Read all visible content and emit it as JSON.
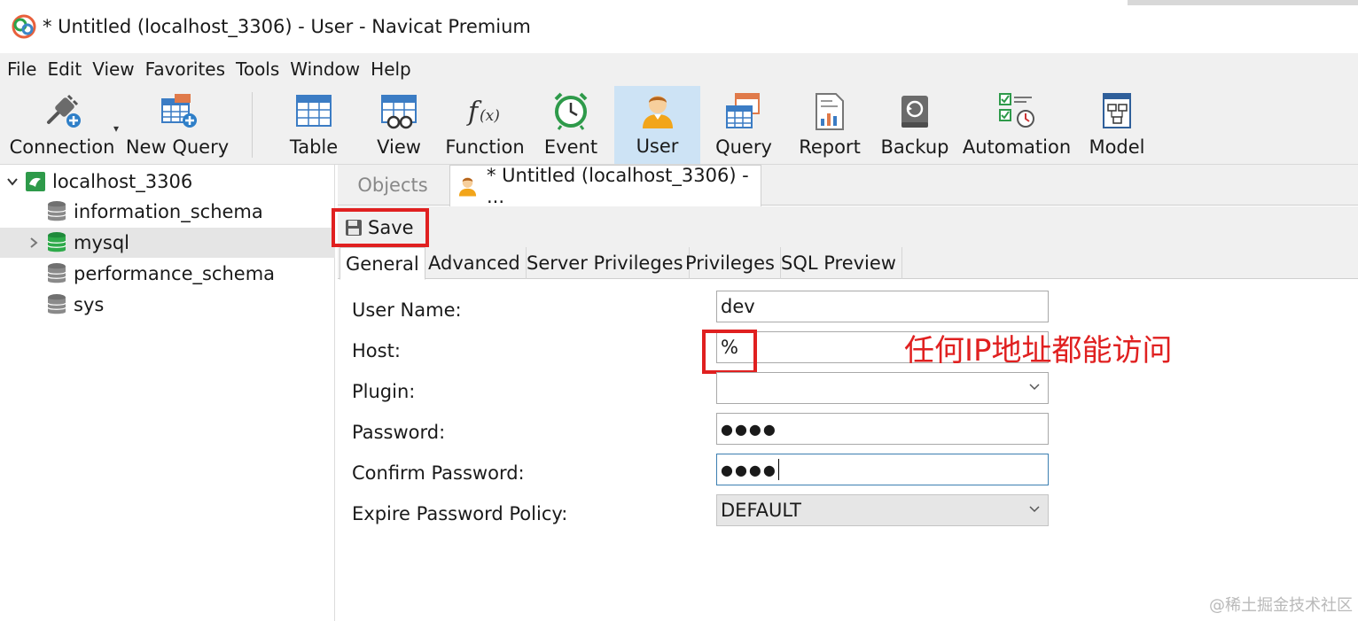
{
  "window": {
    "title": "* Untitled (localhost_3306) - User - Navicat Premium"
  },
  "menu": [
    "File",
    "Edit",
    "View",
    "Favorites",
    "Tools",
    "Window",
    "Help"
  ],
  "toolbar": {
    "connection": "Connection",
    "new_query": "New Query",
    "table": "Table",
    "view": "View",
    "function": "Function",
    "event": "Event",
    "user": "User",
    "query": "Query",
    "report": "Report",
    "backup": "Backup",
    "automation": "Automation",
    "model": "Model"
  },
  "sidebar": {
    "connection": "localhost_3306",
    "databases": [
      "information_schema",
      "mysql",
      "performance_schema",
      "sys"
    ]
  },
  "tabs": {
    "objects": "Objects",
    "document": "* Untitled (localhost_3306) - ..."
  },
  "save_label": "Save",
  "subtabs": [
    "General",
    "Advanced",
    "Server Privileges",
    "Privileges",
    "SQL Preview"
  ],
  "form": {
    "user_name_label": "User Name:",
    "user_name_value": "dev",
    "host_label": "Host:",
    "host_value": "%",
    "plugin_label": "Plugin:",
    "plugin_value": "",
    "password_label": "Password:",
    "password_value": "●●●●",
    "confirm_label": "Confirm Password:",
    "confirm_value": "●●●●",
    "expire_label": "Expire Password Policy:",
    "expire_value": "DEFAULT"
  },
  "annotation": "任何IP地址都能访问",
  "watermark": "@稀土掘金技术社区",
  "colors": {
    "accent": "#cde3f5",
    "annotation_red": "#e02020",
    "toolbar_bg": "#f0f0f0"
  }
}
